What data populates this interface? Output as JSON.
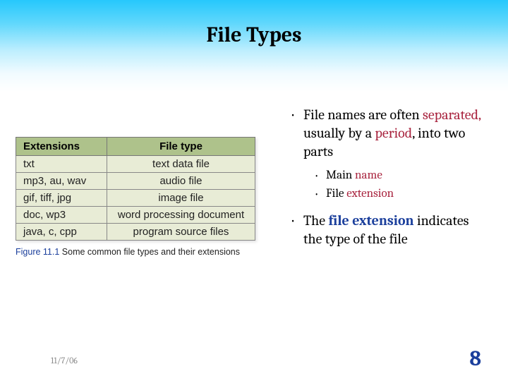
{
  "title": "File Types",
  "table": {
    "headers": {
      "ext": "Extensions",
      "type": "File type"
    },
    "rows": [
      {
        "ext": "txt",
        "type": "text data file"
      },
      {
        "ext": "mp3, au, wav",
        "type": "audio file"
      },
      {
        "ext": "gif, tiff, jpg",
        "type": "image file"
      },
      {
        "ext": "doc, wp3",
        "type": "word processing document"
      },
      {
        "ext": "java, c, cpp",
        "type": "program source files"
      }
    ]
  },
  "caption": {
    "fig": "Figure 11.1",
    "text": "  Some common file types and their extensions"
  },
  "bullets": {
    "b1": {
      "pre": "File names are often ",
      "kw1": "separated,",
      "mid": " usually by a ",
      "kw2": "period",
      "post": ", into two parts"
    },
    "b1sub": {
      "a_pre": "Main ",
      "a_kw": "name",
      "b_pre": "File ",
      "b_kw": "extension"
    },
    "b2": {
      "pre": "The ",
      "kw": "file extension",
      "post": " indicates the type of the file"
    }
  },
  "footer": {
    "date": "11/7/06",
    "page": "8"
  }
}
